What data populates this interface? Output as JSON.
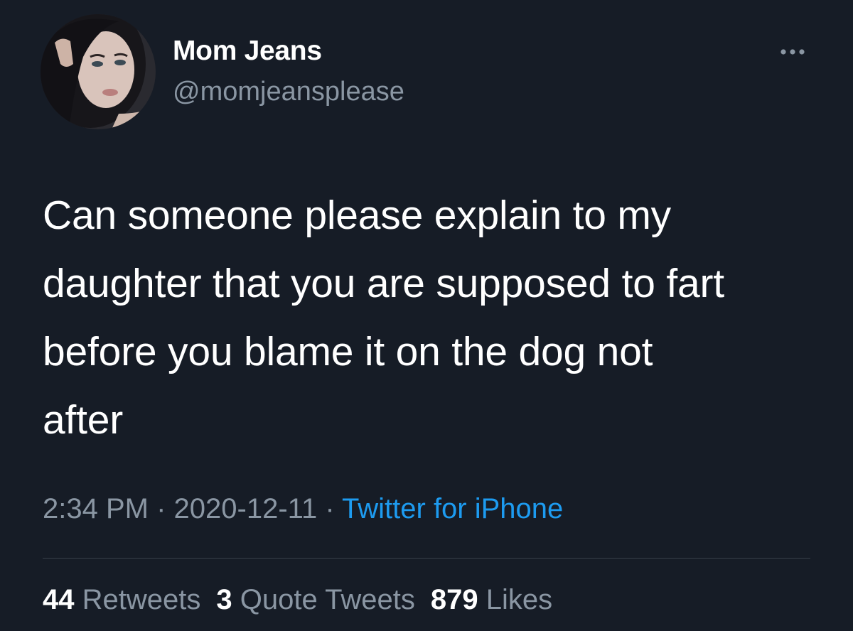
{
  "author": {
    "display_name": "Mom Jeans",
    "handle": "@momjeansplease"
  },
  "icons": {
    "avatar": "profile-photo",
    "more": "more-horizontal-icon"
  },
  "tweet": {
    "text": "Can someone please explain to my daughter that you are supposed to fart before you blame it on the dog not after",
    "lines": [
      "Can someone please explain to my",
      "daughter that you are supposed to fart",
      "before you blame it on the dog not",
      "after"
    ]
  },
  "meta": {
    "time": "2:34 PM",
    "separator": "·",
    "date": "2020-12-11",
    "source": "Twitter for iPhone"
  },
  "stats": {
    "retweets_count": "44",
    "retweets_label": "Retweets",
    "quotes_count": "3",
    "quotes_label": "Quote Tweets",
    "likes_count": "879",
    "likes_label": "Likes"
  },
  "colors": {
    "background": "#161c26",
    "primary_text": "#ffffff",
    "secondary_text": "#8a96a3",
    "link": "#1d9bf0",
    "divider": "#38404a"
  }
}
